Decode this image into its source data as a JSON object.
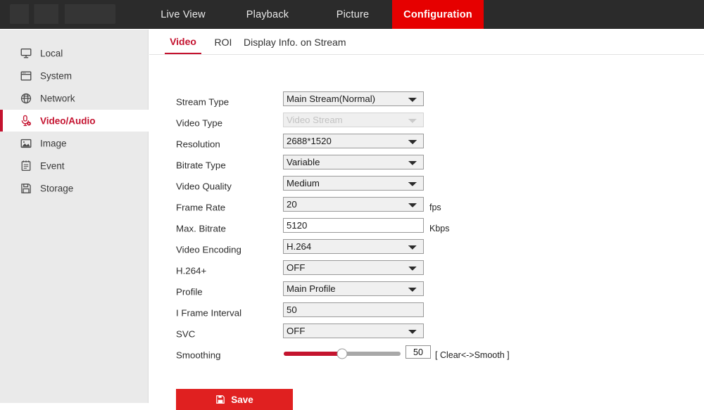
{
  "header": {
    "logo_name": "brand-logo",
    "nav": [
      {
        "id": "live",
        "label": "Live View",
        "active": false
      },
      {
        "id": "playback",
        "label": "Playback",
        "active": false
      },
      {
        "id": "picture",
        "label": "Picture",
        "active": false
      },
      {
        "id": "config",
        "label": "Configuration",
        "active": true
      }
    ]
  },
  "sidebar": {
    "items": [
      {
        "id": "local",
        "label": "Local",
        "icon": "monitor-icon",
        "active": false
      },
      {
        "id": "system",
        "label": "System",
        "icon": "window-icon",
        "active": false
      },
      {
        "id": "network",
        "label": "Network",
        "icon": "globe-icon",
        "active": false
      },
      {
        "id": "video-audio",
        "label": "Video/Audio",
        "icon": "microphone-icon",
        "active": true
      },
      {
        "id": "image",
        "label": "Image",
        "icon": "picture-icon",
        "active": false
      },
      {
        "id": "event",
        "label": "Event",
        "icon": "clipboard-icon",
        "active": false
      },
      {
        "id": "storage",
        "label": "Storage",
        "icon": "floppy-icon",
        "active": false
      }
    ]
  },
  "content": {
    "tabs": [
      {
        "id": "video",
        "label": "Video",
        "active": true
      },
      {
        "id": "roi",
        "label": "ROI",
        "active": false
      },
      {
        "id": "display",
        "label": "Display Info. on Stream",
        "active": false
      }
    ],
    "fields": {
      "stream_type": {
        "label": "Stream Type",
        "value": "Main Stream(Normal)"
      },
      "video_type": {
        "label": "Video Type",
        "value": "Video Stream"
      },
      "resolution": {
        "label": "Resolution",
        "value": "2688*1520"
      },
      "bitrate_type": {
        "label": "Bitrate Type",
        "value": "Variable"
      },
      "video_quality": {
        "label": "Video Quality",
        "value": "Medium"
      },
      "frame_rate": {
        "label": "Frame Rate",
        "value": "20",
        "unit": "fps"
      },
      "max_bitrate": {
        "label": "Max. Bitrate",
        "value": "5120",
        "unit": "Kbps"
      },
      "video_encoding": {
        "label": "Video Encoding",
        "value": "H.264"
      },
      "h264_plus": {
        "label": "H.264+",
        "value": "OFF"
      },
      "profile": {
        "label": "Profile",
        "value": "Main Profile"
      },
      "i_frame_interval": {
        "label": "I Frame Interval",
        "value": "50"
      },
      "svc": {
        "label": "SVC",
        "value": "OFF"
      },
      "smoothing": {
        "label": "Smoothing",
        "value": "50",
        "hint": "[ Clear<->Smooth ]",
        "percent": 50
      }
    },
    "save": {
      "label": "Save",
      "icon": "floppy-save-icon"
    }
  },
  "colors": {
    "accent_red": "#c4122f",
    "nav_active_red": "#e60000",
    "save_red": "#e02020",
    "header_dark": "#2b2b2b",
    "sidebar_grey": "#eaeaea"
  }
}
